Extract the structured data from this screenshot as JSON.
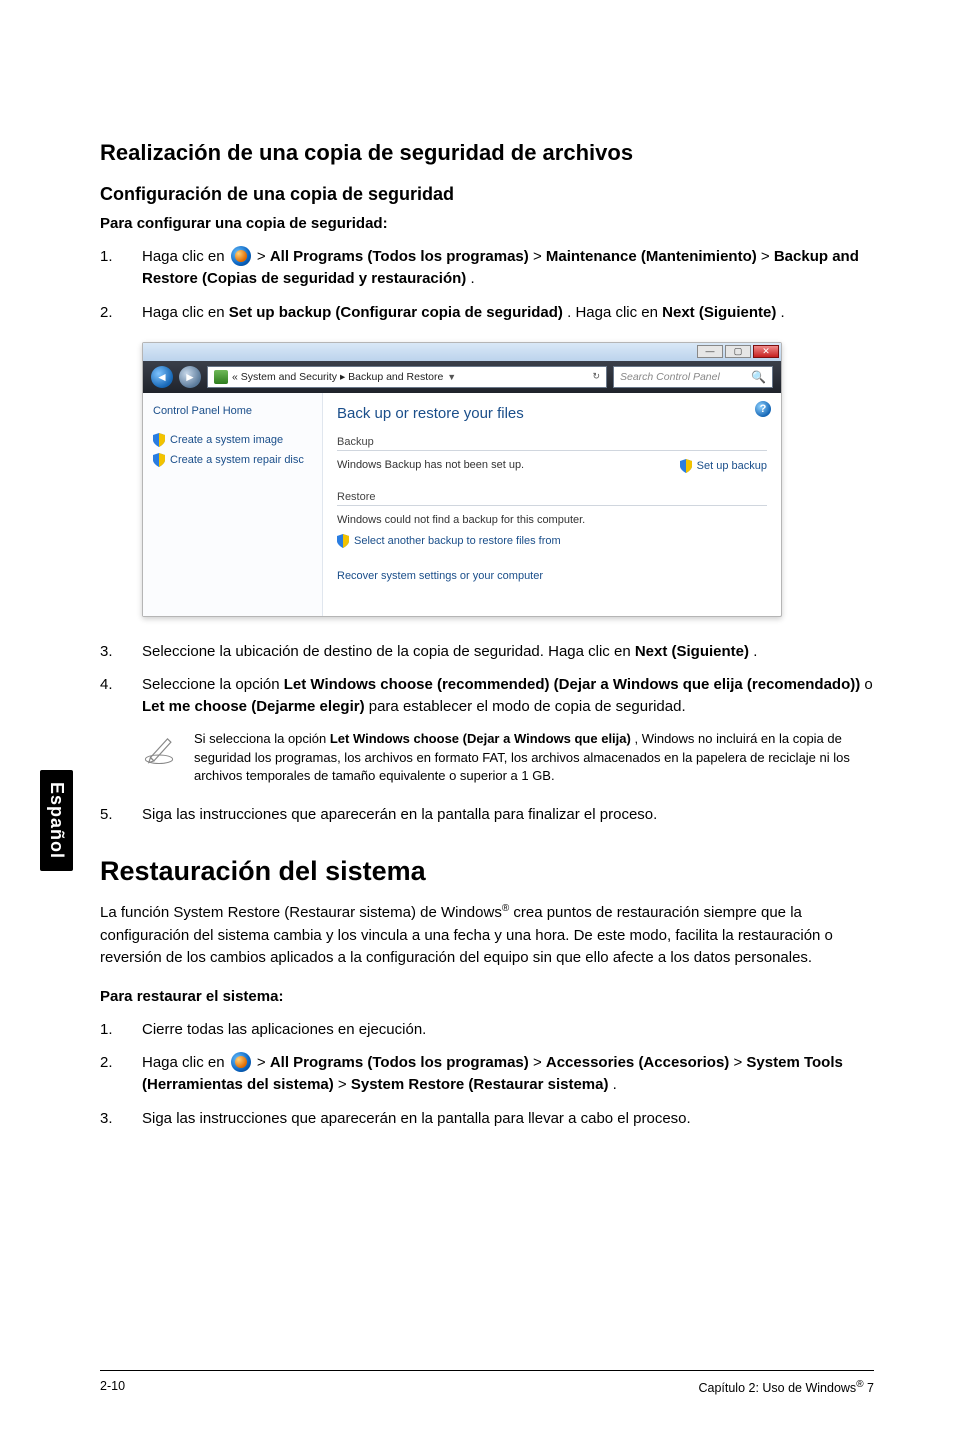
{
  "side_tab": "Español",
  "h_backup_files": "Realización de una copia de seguridad de archivos",
  "h_config": "Configuración de una copia de seguridad",
  "lead_config": "Para configurar una copia de seguridad:",
  "steps_a": {
    "1": {
      "n": "1.",
      "pre": "Haga clic en ",
      "post": " > ",
      "b1": "All Programs (Todos los programas)",
      "sep1": " > ",
      "b2": "Maintenance (Mantenimiento)",
      "sep2": " > ",
      "b3": "Backup and Restore (Copias de seguridad y restauración)",
      "end": "."
    },
    "2": {
      "n": "2.",
      "pre": "Haga clic en ",
      "b1": "Set up backup (Configurar copia de seguridad)",
      "mid": ". Haga clic en ",
      "b2": "Next (Siguiente)",
      "end": "."
    },
    "3": {
      "n": "3.",
      "txt": "Seleccione la ubicación de destino de la copia de seguridad. Haga clic en ",
      "b1": "Next (Siguiente)",
      "end": "."
    },
    "4": {
      "n": "4.",
      "pre": "Seleccione la opción ",
      "b1": "Let Windows choose (recommended) (Dejar a Windows que elija (recomendado))",
      "mid": " o ",
      "b2": "Let me choose (Dejarme elegir)",
      "post": " para establecer el modo de copia de seguridad."
    },
    "5": {
      "n": "5.",
      "txt": "Siga las instrucciones que aparecerán en la pantalla para finalizar el proceso."
    }
  },
  "note": {
    "pre": "Si selecciona la opción ",
    "b": "Let Windows choose (Dejar a Windows que elija)",
    "post": ", Windows no incluirá en la copia de seguridad los programas, los archivos en formato FAT, los archivos almacenados en la papelera de reciclaje ni los archivos temporales de tamaño equivalente o superior a 1 GB."
  },
  "h_restore": "Restauración del sistema",
  "restore_para": {
    "pre": "La función System Restore (Restaurar sistema) de Windows",
    "reg": "®",
    "post": " crea puntos de restauración siempre que la configuración del sistema cambia y los vincula a una fecha y una hora. De este modo, facilita la restauración o reversión de los cambios aplicados a la configuración del equipo sin que ello afecte a los datos personales."
  },
  "lead_restore": "Para restaurar el sistema:",
  "steps_b": {
    "1": {
      "n": "1.",
      "txt": "Cierre todas las aplicaciones en ejecución."
    },
    "2": {
      "n": "2.",
      "pre": "Haga clic en ",
      "post": " > ",
      "b1": "All Programs (Todos los programas)",
      "sep1": " > ",
      "b2": "Accessories (Accesorios)",
      "sep2": " > ",
      "b3": "System Tools (Herramientas del sistema)",
      "sep3": " > ",
      "b4": "System Restore (Restaurar sistema)",
      "end": "."
    },
    "3": {
      "n": "3.",
      "txt": "Siga las instrucciones que aparecerán en la pantalla para llevar a cabo el proceso."
    }
  },
  "screenshot": {
    "breadcrumb": "« System and Security  ▸ Backup and Restore",
    "search_placeholder": "Search Control Panel",
    "cp_home": "Control Panel Home",
    "link_image": "Create a system image",
    "link_repair": "Create a system repair disc",
    "heading": "Back up or restore your files",
    "grp_backup": "Backup",
    "backup_status": "Windows Backup has not been set up.",
    "setup_backup": "Set up backup",
    "grp_restore": "Restore",
    "restore_status": "Windows could not find a backup for this computer.",
    "restore_select": "Select another backup to restore files from",
    "recover": "Recover system settings or your computer",
    "win_min": "—",
    "win_max": "▢",
    "win_close": "✕",
    "help": "?"
  },
  "footer": {
    "left": "2-10",
    "right_pre": "Capítulo 2: Uso de Windows",
    "reg": "®",
    "right_post": " 7"
  }
}
